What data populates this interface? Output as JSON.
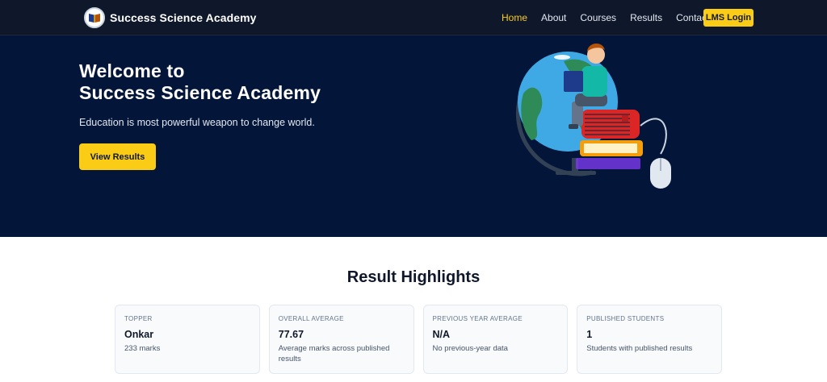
{
  "brand": {
    "name": "Success Science Academy",
    "logo_icon": "book-icon"
  },
  "nav": {
    "items": [
      {
        "label": "Home",
        "active": true
      },
      {
        "label": "About",
        "active": false
      },
      {
        "label": "Courses",
        "active": false
      },
      {
        "label": "Results",
        "active": false
      },
      {
        "label": "Contact",
        "active": false
      }
    ],
    "login_label": "LMS Login"
  },
  "hero": {
    "title_line1": "Welcome to",
    "title_line2": "Success Science Academy",
    "subtitle": "Education is most powerful weapon to change world.",
    "button_label": "View Results",
    "illustration_icon": "student-globe-books-illustration"
  },
  "highlights": {
    "title": "Result Highlights",
    "cards": [
      {
        "label": "TOPPER",
        "value": "Onkar",
        "note": "233 marks"
      },
      {
        "label": "OVERALL AVERAGE",
        "value": "77.67",
        "note": "Average marks across published results"
      },
      {
        "label": "PREVIOUS YEAR AVERAGE",
        "value": "N/A",
        "note": "No previous-year data"
      },
      {
        "label": "PUBLISHED STUDENTS",
        "value": "1",
        "note": "Students with published results"
      }
    ]
  },
  "colors": {
    "nav_bg": "#0f172a",
    "hero_bg": "#04153a",
    "accent": "#facc15",
    "card_bg": "#f8fafc"
  }
}
